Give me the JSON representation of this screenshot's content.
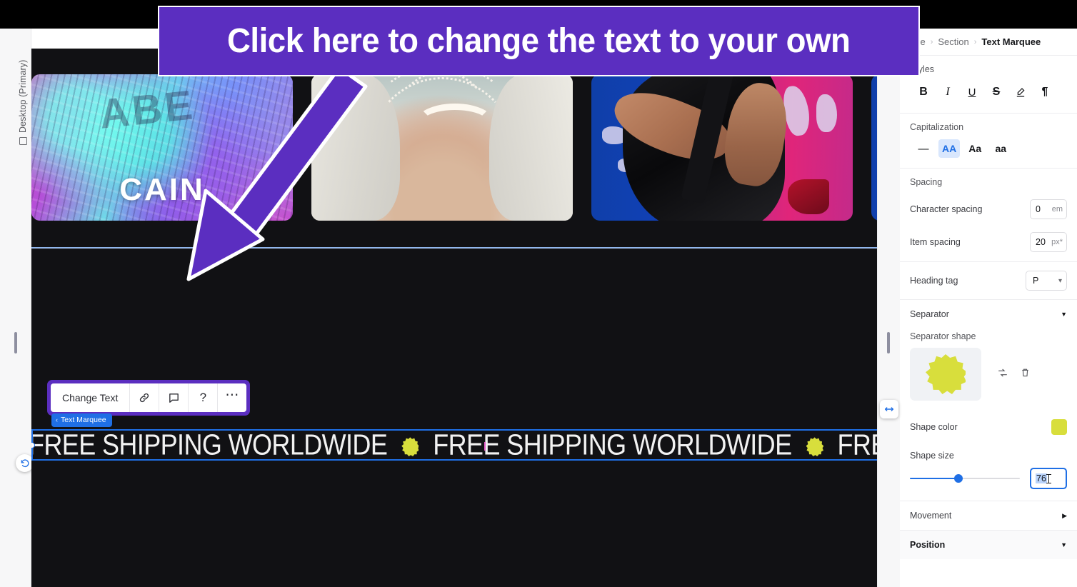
{
  "annotation": {
    "banner_text": "Click here to change the text to your own",
    "banner_color": "#5b2ec0",
    "arrow_color": "#5b2ec0"
  },
  "left_rail": {
    "viewport_label": "Desktop (Primary)",
    "monitor_icon": "monitor-icon",
    "undo_icon": "undo-icon",
    "handle_icon": "drag-handle"
  },
  "canvas": {
    "gallery": {
      "items": [
        {
          "alt": "holographic outfit",
          "caption": "CAIN",
          "ghost_text": "ABE"
        },
        {
          "alt": "pearl necklaces on white top",
          "caption": ""
        },
        {
          "alt": "black outfit against graffiti wall",
          "caption": ""
        },
        {
          "alt": "next slide partial",
          "caption": ""
        }
      ]
    },
    "toolbar": {
      "change_text_label": "Change Text",
      "link_icon": "link-icon",
      "comment_icon": "comment-icon",
      "help_icon": "help-icon",
      "more_icon": "more-options-icon"
    },
    "element_tag": {
      "label": "Text Marquee",
      "chevron": "‹"
    },
    "marquee": {
      "item_text": "FREE SHIPPING WORLDWIDE",
      "separator_icon": "star-burst-icon",
      "separator_color": "#d8de3c",
      "selection_color": "#1f6fe5",
      "repeat_count": 3
    },
    "resize_handle_icon": "horizontal-resize-icon"
  },
  "panel": {
    "breadcrumb": [
      "age",
      "Section",
      "Text Marquee"
    ],
    "breadcrumb_separator": "›",
    "styles": {
      "label": "Styles",
      "buttons": [
        {
          "name": "bold",
          "glyph": "B"
        },
        {
          "name": "italic",
          "glyph": "I"
        },
        {
          "name": "underline",
          "glyph": "U"
        },
        {
          "name": "strikethrough",
          "glyph": "S"
        },
        {
          "name": "highlight",
          "glyph": "✐"
        },
        {
          "name": "paragraph",
          "glyph": "¶"
        }
      ]
    },
    "capitalization": {
      "label": "Capitalization",
      "options": [
        {
          "glyph": "—",
          "active": false,
          "name": "none"
        },
        {
          "glyph": "AA",
          "active": true,
          "name": "uppercase"
        },
        {
          "glyph": "Aa",
          "active": false,
          "name": "capitalize"
        },
        {
          "glyph": "aa",
          "active": false,
          "name": "lowercase"
        }
      ]
    },
    "spacing": {
      "label": "Spacing",
      "character_spacing": {
        "label": "Character spacing",
        "value": "0",
        "unit": "em"
      },
      "item_spacing": {
        "label": "Item spacing",
        "value": "20",
        "unit": "px*"
      }
    },
    "heading_tag": {
      "label": "Heading tag",
      "value": "P"
    },
    "separator": {
      "label": "Separator",
      "expanded": true
    },
    "separator_shape": {
      "label": "Separator shape",
      "replace_icon": "replace-icon",
      "delete_icon": "trash-icon"
    },
    "shape_color": {
      "label": "Shape color",
      "value": "#d8de3c"
    },
    "shape_size": {
      "label": "Shape size",
      "value": "76",
      "fill_percent": 44
    },
    "movement": {
      "label": "Movement",
      "expanded": false
    },
    "position": {
      "label": "Position",
      "expanded": true
    }
  }
}
